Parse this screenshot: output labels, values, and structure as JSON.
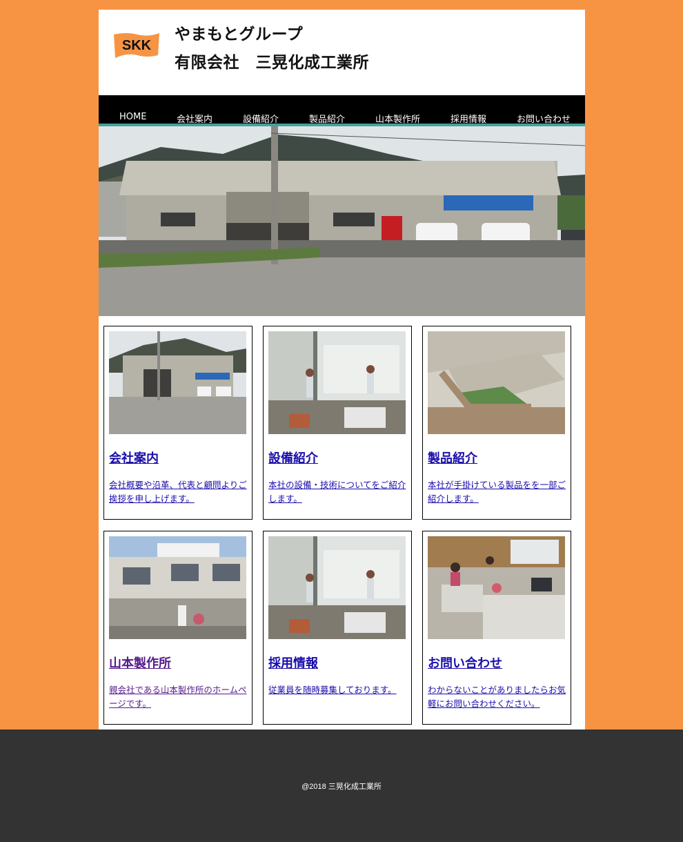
{
  "header": {
    "logo_text": "SKK",
    "group_name": "やまもとグループ",
    "company_name": "有限会社　三晃化成工業所"
  },
  "nav": {
    "items": [
      {
        "label": "HOME"
      },
      {
        "label": "会社案内"
      },
      {
        "label": "設備紹介"
      },
      {
        "label": "製品紹介"
      },
      {
        "label": "山本製作所"
      },
      {
        "label": "採用情報"
      },
      {
        "label": "お問い合わせ"
      }
    ]
  },
  "cards": [
    {
      "title": "会社案内",
      "desc": "会社概要や沿革、代表と顧問よりご挨拶を申し上げます。"
    },
    {
      "title": "設備紹介",
      "desc": "本社の設備・技術についてをご紹介します。"
    },
    {
      "title": "製品紹介",
      "desc": "本社が手掛けている製品をを一部ご紹介します。"
    },
    {
      "title": "山本製作所",
      "desc": "親会社である山本製作所のホームページです。"
    },
    {
      "title": "採用情報",
      "desc": "従業員を随時募集しております。"
    },
    {
      "title": "お問い合わせ",
      "desc": "わからないことがありましたらお気軽にお問い合わせください。"
    }
  ],
  "footer": {
    "copyright": "@2018 三晃化成工業所"
  },
  "colors": {
    "background": "#f79444",
    "nav_bg": "#000000",
    "nav_accent": "#3fa39c",
    "link": "#1a0dab",
    "visited_link": "#551a8b",
    "footer_bg": "#333333"
  }
}
